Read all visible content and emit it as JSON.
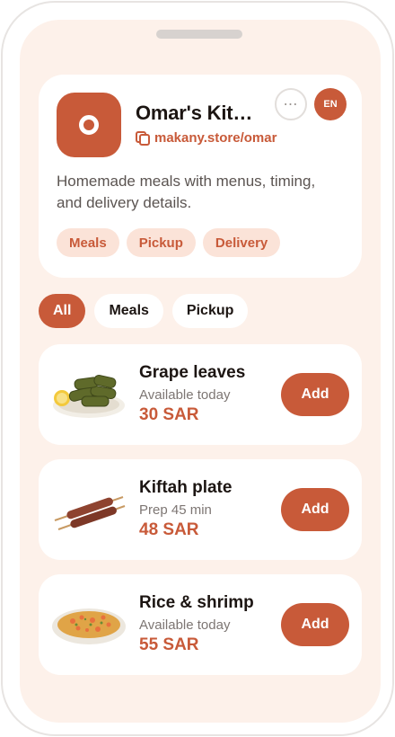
{
  "store": {
    "name": "Omar's Kitchen",
    "link": "makany.store/omar",
    "language": "EN",
    "more_icon": "more-horizontal-icon",
    "description": "Homemade meals with menus, timing, and delivery details.",
    "tags": [
      "Meals",
      "Pickup",
      "Delivery"
    ]
  },
  "filters": [
    {
      "label": "All",
      "active": true
    },
    {
      "label": "Meals",
      "active": false
    },
    {
      "label": "Pickup",
      "active": false
    }
  ],
  "products": [
    {
      "name": "Grape leaves",
      "meta": "Available today",
      "price": "30 SAR",
      "button": "Add",
      "image": "grape-leaves-image"
    },
    {
      "name": "Kiftah plate",
      "meta": "Prep 45 min",
      "price": "48 SAR",
      "button": "Add",
      "image": "kofta-skewers-image"
    },
    {
      "name": "Rice & shrimp",
      "meta": "Available today",
      "price": "55 SAR",
      "button": "Add",
      "image": "rice-shrimp-image"
    }
  ],
  "colors": {
    "accent": "#c85a39",
    "background": "#fdf1ea",
    "tag_background": "#fbe3d8"
  }
}
